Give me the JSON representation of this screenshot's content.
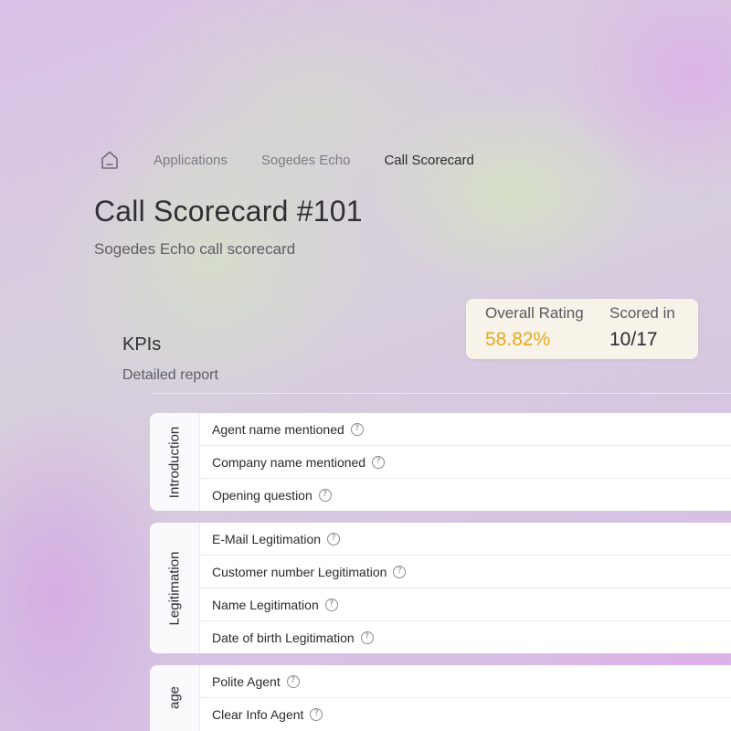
{
  "breadcrumb": {
    "home_icon": "home-icon",
    "items": [
      "Applications",
      "Sogedes Echo"
    ],
    "current": "Call Scorecard"
  },
  "page": {
    "title": "Call Scorecard #101",
    "subtitle": "Sogedes Echo call scorecard"
  },
  "stats": {
    "overall_rating_label": "Overall Rating",
    "overall_rating_value": "58.82%",
    "scored_in_label": "Scored in",
    "scored_in_value": "10/17",
    "accent_color": "#e8a91c"
  },
  "kpis": {
    "heading": "KPIs",
    "subheading": "Detailed report",
    "help_icon": "question-circle-icon",
    "groups": [
      {
        "label": "Introduction",
        "items": [
          "Agent name mentioned",
          "Company name mentioned",
          "Opening question"
        ]
      },
      {
        "label": "Legitimation",
        "items": [
          "E-Mail Legitimation",
          "Customer number Legitimation",
          "Name Legitimation",
          "Date of birth Legitimation"
        ]
      },
      {
        "label": "age",
        "items": [
          "Polite Agent",
          "Clear Info Agent"
        ]
      }
    ]
  }
}
